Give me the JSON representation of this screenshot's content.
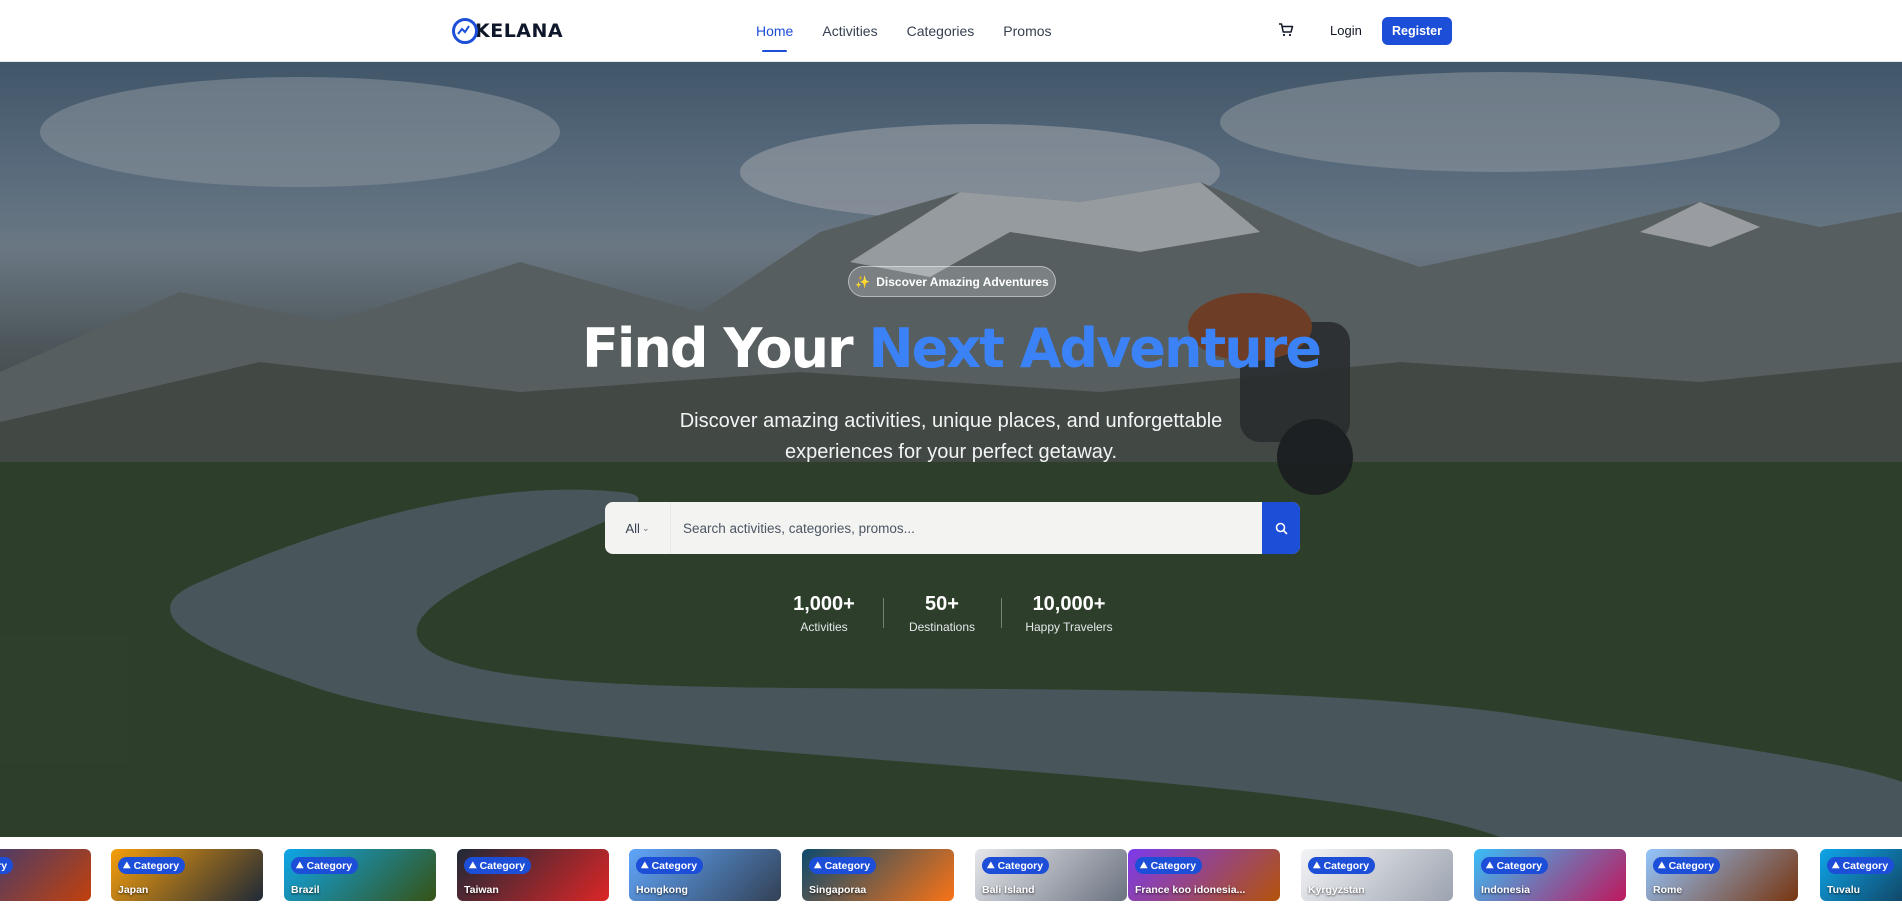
{
  "brand": {
    "logo_text": "KELANA",
    "accent_color": "#1d4ed8",
    "highlight_color": "#3b82f6"
  },
  "nav": {
    "links": [
      {
        "label": "Home",
        "active": true
      },
      {
        "label": "Activities",
        "active": false
      },
      {
        "label": "Categories",
        "active": false
      },
      {
        "label": "Promos",
        "active": false
      }
    ],
    "cart_icon": "cart-icon",
    "login_label": "Login",
    "register_label": "Register"
  },
  "hero": {
    "badge": "Discover Amazing Adventures",
    "badge_icon": "sparkles-icon",
    "headline_start": "Find Your ",
    "headline_accent": "Next Adventure",
    "subtext": "Discover amazing activities, unique places, and unforgettable experiences for your perfect getaway.",
    "search": {
      "filter_value": "All",
      "placeholder": "Search activities, categories, promos...",
      "button_icon": "search-icon"
    },
    "stats": [
      {
        "value": "1,000+",
        "label": "Activities"
      },
      {
        "value": "50+",
        "label": "Destinations"
      },
      {
        "value": "10,000+",
        "label": "Happy Travelers"
      }
    ]
  },
  "categories": {
    "chip_label": "Category",
    "chip_icon": "mountain-icon",
    "items": [
      {
        "name": "",
        "colors": [
          "#1e3a8a",
          "#c2410c"
        ]
      },
      {
        "name": "Japan",
        "colors": [
          "#f59e0b",
          "#1f2937"
        ]
      },
      {
        "name": "Brazil",
        "colors": [
          "#0ea5e9",
          "#365314"
        ]
      },
      {
        "name": "Taiwan",
        "colors": [
          "#1f2937",
          "#dc2626"
        ]
      },
      {
        "name": "Hongkong",
        "colors": [
          "#60a5fa",
          "#334155"
        ]
      },
      {
        "name": "Singaporaa",
        "colors": [
          "#0c4a6e",
          "#f97316"
        ]
      },
      {
        "name": "Bali Island",
        "colors": [
          "#e5e7eb",
          "#6b7280"
        ]
      },
      {
        "name": "France koo idonesia...",
        "colors": [
          "#7c3aed",
          "#b45309"
        ]
      },
      {
        "name": "Kyrgyzstan",
        "colors": [
          "#f3f4f6",
          "#9ca3af"
        ]
      },
      {
        "name": "Indonesia",
        "colors": [
          "#38bdf8",
          "#be185d"
        ]
      },
      {
        "name": "Rome",
        "colors": [
          "#93c5fd",
          "#78350f"
        ]
      },
      {
        "name": "Tuvalu",
        "colors": [
          "#0ea5e9",
          "#111827"
        ]
      }
    ]
  }
}
